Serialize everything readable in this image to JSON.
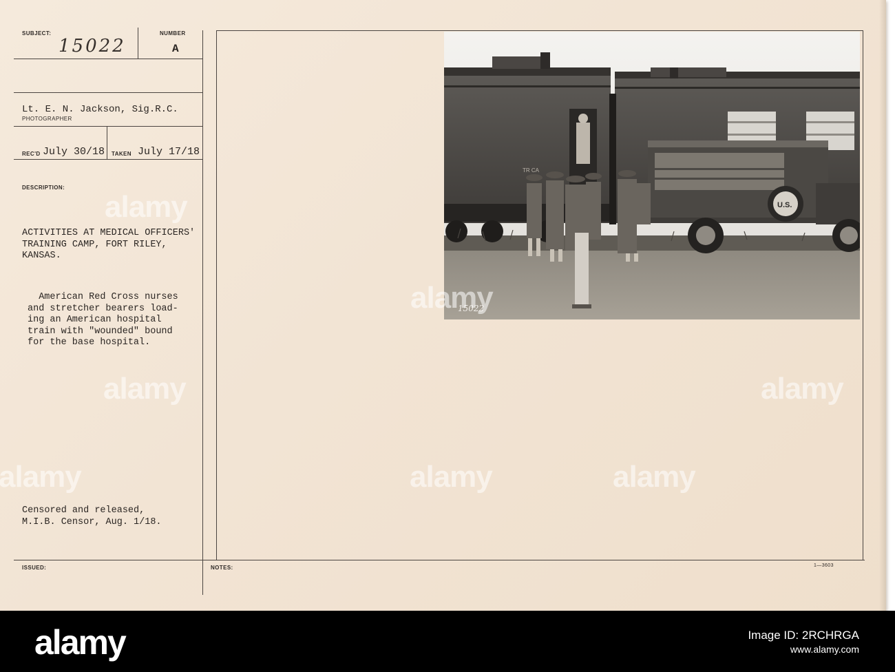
{
  "card": {
    "subject_label": "SUBJECT:",
    "subject_value": "15022",
    "number_label": "NUMBER",
    "number_value": "A",
    "photographer_value": "Lt. E. N. Jackson, Sig.R.C.",
    "photographer_label": "PHOTOGRAPHER",
    "recd_label": "REC'D",
    "recd_value": "July 30/18",
    "taken_label": "TAKEN",
    "taken_value": "July 17/18",
    "description_label": "DESCRIPTION:",
    "title_lines": [
      "ACTIVITIES AT MEDICAL OFFICERS'",
      "TRAINING CAMP, FORT RILEY,",
      "KANSAS."
    ],
    "body_lines": [
      "  American Red Cross nurses",
      "and stretcher bearers load-",
      "ing an American hospital",
      "train with \"wounded\" bound",
      "for the base hospital."
    ],
    "censor_lines": [
      "Censored and released,",
      "M.I.B. Censor, Aug. 1/18."
    ],
    "issued_label": "ISSUED:",
    "notes_label": "NOTES:",
    "form_number": "1—3603"
  },
  "photo": {
    "negative_number": "15022",
    "truck_marking": "U.S.",
    "car_lettering": "TR  CA"
  },
  "watermark": {
    "text": "alamy"
  },
  "footer": {
    "logo": "alamy",
    "image_id_label": "Image ID: 2RCHRGA",
    "site": "www.alamy.com"
  },
  "colors": {
    "card": "#f3e6d6",
    "ink": "#2a2522",
    "footer": "#000000"
  }
}
